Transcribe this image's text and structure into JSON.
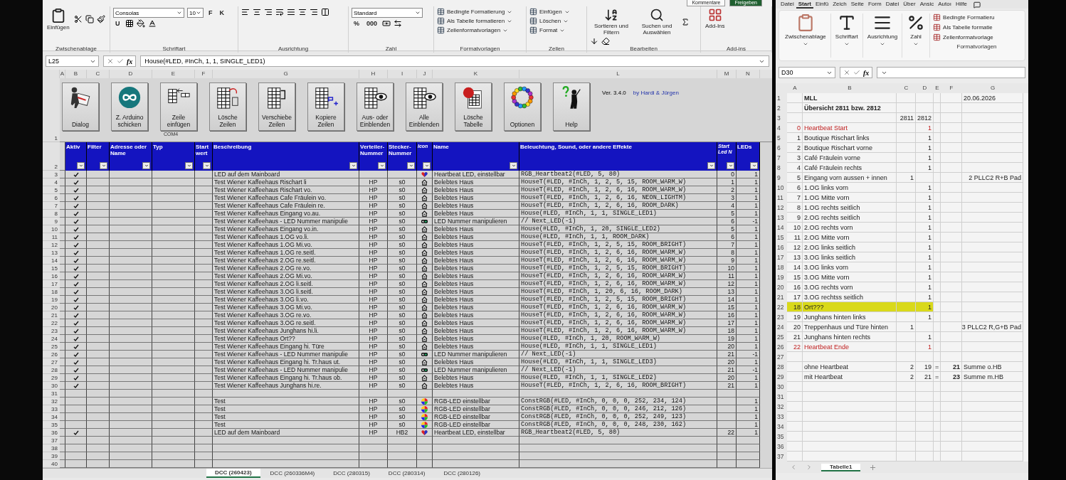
{
  "left_window": {
    "top_buttons": [
      "Kommentare",
      "Freigeben"
    ],
    "ribbon": [
      {
        "label": "Zwischenablage",
        "controls": [
          {
            "kind": "large",
            "label": "Einfügen"
          }
        ]
      },
      {
        "label": "Schriftart",
        "controls": [
          {
            "kind": "field",
            "value": "Consolas"
          },
          {
            "kind": "field",
            "value": "10"
          },
          {
            "kind": "glyph",
            "label": "F"
          },
          {
            "kind": "glyph",
            "label": "K"
          },
          {
            "kind": "glyph",
            "label": "U"
          }
        ]
      },
      {
        "label": "Ausrichtung"
      },
      {
        "label": "Zahl",
        "controls": [
          {
            "kind": "field",
            "value": "Standard"
          },
          {
            "kind": "glyph",
            "label": "%"
          },
          {
            "kind": "glyph",
            "label": "000"
          }
        ]
      },
      {
        "label": "Formatvorlagen",
        "controls": [
          {
            "kind": "small",
            "label": "Bedingte Formatierung"
          },
          {
            "kind": "small",
            "label": "Als Tabelle formatieren"
          },
          {
            "kind": "small",
            "label": "Zellenformatvorlagen"
          }
        ]
      },
      {
        "label": "Zellen",
        "controls": [
          {
            "kind": "small",
            "label": "Einfügen"
          },
          {
            "kind": "small",
            "label": "Löschen"
          },
          {
            "kind": "small",
            "label": "Format"
          }
        ]
      },
      {
        "label": "Bearbeiten",
        "controls": [
          {
            "kind": "large",
            "label": "Sortieren und Filtern"
          },
          {
            "kind": "large",
            "label": "Suchen und Auswählen"
          }
        ]
      },
      {
        "label": "Add-ins",
        "controls": [
          {
            "kind": "large",
            "label": "Add-Ins"
          }
        ]
      }
    ],
    "name_box": "L25",
    "fx": "fx",
    "formula": "House(#LED, #InCh, 1, 1, SINGLE_LED1)",
    "columns": [
      "A",
      "B",
      "C",
      "D",
      "E",
      "F",
      "G",
      "H",
      "I",
      "J",
      "K",
      "L",
      "M",
      "N"
    ],
    "macro_buttons": [
      "Dialog",
      "Z. Arduino schicken",
      "Zeile einfügen",
      "Lösche Zeilen",
      "Verschiebe Zeilen",
      "Kopiere Zeilen",
      "Aus- oder Einblenden",
      "Alle Einblenden",
      "Lösche Tabelle",
      "Optionen",
      "Help"
    ],
    "header_rows": [
      "1",
      "2"
    ],
    "version": "Ver. 3.4.0",
    "authors": "by Hardi & Jürgen",
    "port": "COM4",
    "headers": [
      "Aktiv",
      "Filter",
      "Adresse oder Name",
      "Typ",
      "Start wert",
      "Beschreibung",
      "Verteiler-Nummer",
      "Stecker-Nummer",
      "Icon",
      "Name",
      "Beleuchtung, Sound, oder andere Effekte",
      "Start Led N",
      "LEDs"
    ],
    "rows": [
      {
        "row": "3",
        "aktiv": true,
        "beschreibung": "LED auf dem Mainboard",
        "kind": "heart",
        "name": "Heartbeat LED, einstellbar",
        "effekt": "RGB_Heartbeat2(#LED, 5, 80)",
        "start_led": "0",
        "leds": "1"
      },
      {
        "row": "4",
        "aktiv": true,
        "beschreibung": "Test Wiener Kaffeehaus Rischart li",
        "verteiler": "HP",
        "stecker": "s0",
        "kind": "house",
        "name": "Belebtes Haus",
        "effekt": "HouseT(#LED, #InCh, 1, 2, 5, 15, ROOM_WARM_W)",
        "start_led": "1",
        "leds": "1"
      },
      {
        "row": "5",
        "aktiv": true,
        "beschreibung": "Test Wiener Kaffeehaus Rischart vo.",
        "verteiler": "HP",
        "stecker": "s0",
        "kind": "house",
        "name": "Belebtes Haus",
        "effekt": "HouseT(#LED, #InCh, 1, 2, 6, 16, ROOM_WARM_W)",
        "start_led": "2",
        "leds": "1"
      },
      {
        "row": "6",
        "aktiv": true,
        "beschreibung": "Test Wiener Kaffeehaus Cafe Fräulein vo.",
        "verteiler": "HP",
        "stecker": "s0",
        "kind": "house",
        "name": "Belebtes Haus",
        "effekt": "HouseT(#LED, #InCh, 1, 2, 6, 16, NEON_LIGHTM)",
        "start_led": "3",
        "leds": "1"
      },
      {
        "row": "7",
        "aktiv": true,
        "beschreibung": "Test Wiener Kaffeehaus Cafe Fräulein re.",
        "verteiler": "HP",
        "stecker": "s0",
        "kind": "house",
        "name": "Belebtes Haus",
        "effekt": "HouseT(#LED, #InCh, 1, 2, 6, 16, ROOM_DARK)",
        "start_led": "4",
        "leds": "1"
      },
      {
        "row": "8",
        "aktiv": true,
        "beschreibung": "Test Wiener Kaffeehaus Eingang vo.au.",
        "verteiler": "HP",
        "stecker": "s0",
        "kind": "house",
        "name": "Belebtes Haus",
        "effekt": "House(#LED, #InCh, 1, 1, SINGLE_LED1)",
        "start_led": "5",
        "leds": "1"
      },
      {
        "row": "9",
        "aktiv": true,
        "beschreibung": "Test Wiener Kaffeehaus - LED Nummer manipulie",
        "verteiler": "HP",
        "stecker": "s0",
        "kind": "link",
        "name": "LED Nummer manipulieren",
        "effekt": "// Next_LED(-1)",
        "start_led": "6",
        "leds": "-1"
      },
      {
        "row": "10",
        "aktiv": true,
        "beschreibung": "Test Wiener Kaffeehaus Eingang vo.in.",
        "verteiler": "HP",
        "stecker": "s0",
        "kind": "house",
        "name": "Belebtes Haus",
        "effekt": "House(#LED, #InCh, 1, 20, SINGLE_LED2)",
        "start_led": "5",
        "leds": "1"
      },
      {
        "row": "11",
        "aktiv": true,
        "beschreibung": "Test Wiener Kaffeehaus 1.OG vo.li.",
        "verteiler": "HP",
        "stecker": "s0",
        "kind": "house",
        "name": "Belebtes Haus",
        "effekt": "House(#LED, #InCh, 1, 1, ROOM_DARK)",
        "start_led": "6",
        "leds": "1"
      },
      {
        "row": "12",
        "aktiv": true,
        "beschreibung": "Test Wiener Kaffeehaus 1.OG Mi.vo.",
        "verteiler": "HP",
        "stecker": "s0",
        "kind": "house",
        "name": "Belebtes Haus",
        "effekt": "HouseT(#LED, #InCh, 1, 2, 5, 15, ROOM_BRIGHT)",
        "start_led": "7",
        "leds": "1"
      },
      {
        "row": "13",
        "aktiv": true,
        "beschreibung": "Test Wiener Kaffeehaus 1.OG re.seitl.",
        "verteiler": "HP",
        "stecker": "s0",
        "kind": "house",
        "name": "Belebtes Haus",
        "effekt": "HouseT(#LED, #InCh, 1, 2, 6, 16, ROOM_WARM_W)",
        "start_led": "8",
        "leds": "1"
      },
      {
        "row": "14",
        "aktiv": true,
        "beschreibung": "Test Wiener Kaffeehaus 2.OG re.seitl.",
        "verteiler": "HP",
        "stecker": "s0",
        "kind": "house",
        "name": "Belebtes Haus",
        "effekt": "HouseT(#LED, #InCh, 1, 2, 6, 16, ROOM_WARM_W)",
        "start_led": "9",
        "leds": "1"
      },
      {
        "row": "15",
        "aktiv": true,
        "beschreibung": "Test Wiener Kaffeehaus 2.OG re.vo.",
        "verteiler": "HP",
        "stecker": "s0",
        "kind": "house",
        "name": "Belebtes Haus",
        "effekt": "HouseT(#LED, #InCh, 1, 2, 5, 15, ROOM_BRIGHT)",
        "start_led": "10",
        "leds": "1"
      },
      {
        "row": "16",
        "aktiv": true,
        "beschreibung": "Test Wiener Kaffeehaus 2.OG Mi.vo.",
        "verteiler": "HP",
        "stecker": "s0",
        "kind": "house",
        "name": "Belebtes Haus",
        "effekt": "HouseT(#LED, #InCh, 1, 2, 6, 16, ROOM_WARM_W)",
        "start_led": "11",
        "leds": "1"
      },
      {
        "row": "17",
        "aktiv": true,
        "beschreibung": "Test Wiener Kaffeehaus 2.OG li.seitl.",
        "verteiler": "HP",
        "stecker": "s0",
        "kind": "house",
        "name": "Belebtes Haus",
        "effekt": "HouseT(#LED, #InCh, 1, 2, 6, 16, ROOM_WARM_W)",
        "start_led": "12",
        "leds": "1"
      },
      {
        "row": "18",
        "aktiv": true,
        "beschreibung": "Test Wiener Kaffeehaus 3.OG li.seitl.",
        "verteiler": "HP",
        "stecker": "s0",
        "kind": "house",
        "name": "Belebtes Haus",
        "effekt": "HouseT(#LED, #InCh, 1, 20, 6, 16, ROOM_DARK)",
        "start_led": "13",
        "leds": "1"
      },
      {
        "row": "19",
        "aktiv": true,
        "beschreibung": "Test Wiener Kaffeehaus 3.OG li.vo.",
        "verteiler": "HP",
        "stecker": "s0",
        "kind": "house",
        "name": "Belebtes Haus",
        "effekt": "HouseT(#LED, #InCh, 1, 2, 5, 15, ROOM_BRIGHT)",
        "start_led": "14",
        "leds": "1"
      },
      {
        "row": "20",
        "aktiv": true,
        "beschreibung": "Test Wiener Kaffeehaus 3.OG Mi.vo.",
        "verteiler": "HP",
        "stecker": "s0",
        "kind": "house",
        "name": "Belebtes Haus",
        "effekt": "HouseT(#LED, #InCh, 1, 2, 6, 16, ROOM_WARM_W)",
        "start_led": "15",
        "leds": "1"
      },
      {
        "row": "21",
        "aktiv": true,
        "beschreibung": "Test Wiener Kaffeehaus 3.OG re.vo.",
        "verteiler": "HP",
        "stecker": "s0",
        "kind": "house",
        "name": "Belebtes Haus",
        "effekt": "HouseT(#LED, #InCh, 1, 2, 6, 16, ROOM_WARM_W)",
        "start_led": "16",
        "leds": "1"
      },
      {
        "row": "22",
        "aktiv": true,
        "beschreibung": "Test Wiener Kaffeehaus 3.OG re.seitl.",
        "verteiler": "HP",
        "stecker": "s0",
        "kind": "house",
        "name": "Belebtes Haus",
        "effekt": "HouseT(#LED, #InCh, 1, 2, 6, 16, ROOM_WARM_W)",
        "start_led": "17",
        "leds": "1"
      },
      {
        "row": "23",
        "aktiv": true,
        "beschreibung": "Test Wiener Kaffeehaus Junghans hi.li.",
        "verteiler": "HP",
        "stecker": "s0",
        "kind": "house",
        "name": "Belebtes Haus",
        "effekt": "HouseT(#LED, #InCh, 1, 2, 6, 16, ROOM_WARM_W)",
        "start_led": "18",
        "leds": "1"
      },
      {
        "row": "24",
        "aktiv": true,
        "beschreibung": "Test Wiener Kaffeehaus Ort??",
        "verteiler": "HP",
        "stecker": "s0",
        "kind": "house",
        "name": "Belebtes Haus",
        "effekt": "House(#LED, #InCh, 1, 20, ROOM_WARM_W)",
        "start_led": "19",
        "leds": "1"
      },
      {
        "row": "25",
        "aktiv": true,
        "beschreibung": "Test Wiener Kaffeehaus Eingang hi. Türe",
        "verteiler": "HP",
        "stecker": "s0",
        "kind": "house",
        "name": "Belebtes Haus",
        "effekt": "House(#LED, #InCh, 1, 1, SINGLE_LED1)",
        "start_led": "20",
        "leds": "1"
      },
      {
        "row": "26",
        "aktiv": true,
        "beschreibung": "Test Wiener Kaffeehaus - LED Nummer manipulie",
        "verteiler": "HP",
        "stecker": "s0",
        "kind": "link",
        "name": "LED Nummer manipulieren",
        "effekt": "// Next_LED(-1)",
        "start_led": "21",
        "leds": "-1"
      },
      {
        "row": "27",
        "aktiv": true,
        "beschreibung": "Test Wiener Kaffeehaus Eingang hi. Tr.haus ut.",
        "verteiler": "HP",
        "stecker": "s0",
        "kind": "house",
        "name": "Belebtes Haus",
        "effekt": "House(#LED, #InCh, 1, 1, SINGLE_LED3)",
        "start_led": "20",
        "leds": "1"
      },
      {
        "row": "28",
        "aktiv": true,
        "beschreibung": "Test Wiener Kaffeehaus - LED Nummer manipulie",
        "verteiler": "HP",
        "stecker": "s0",
        "kind": "link",
        "name": "LED Nummer manipulieren",
        "effekt": "// Next_LED(-1)",
        "start_led": "21",
        "leds": "-1"
      },
      {
        "row": "29",
        "aktiv": true,
        "beschreibung": "Test Wiener Kaffeehaus Eingang hi. Tr.haus ob.",
        "verteiler": "HP",
        "stecker": "s0",
        "kind": "house",
        "name": "Belebtes Haus",
        "effekt": "House(#LED, #InCh, 1, 1, SINGLE_LED2)",
        "start_led": "20",
        "leds": "1"
      },
      {
        "row": "30",
        "aktiv": true,
        "beschreibung": "Test Wiener Kaffeehaus Junghans hi.re.",
        "verteiler": "HP",
        "stecker": "s0",
        "kind": "house",
        "name": "Belebtes Haus",
        "effekt": "HouseT(#LED, #InCh, 1, 2, 6, 16, ROOM_BRIGHT)",
        "start_led": "21",
        "leds": "1"
      },
      {
        "row": "31",
        "aktiv": false,
        "kind": "none"
      },
      {
        "row": "32",
        "aktiv": false,
        "beschreibung": "Test",
        "verteiler": "HP",
        "stecker": "s0",
        "kind": "rgb",
        "name": "RGB-LED einstellbar",
        "effekt": "ConstRGB(#LED, #InCh, 0, 0, 0, 252, 234, 124)",
        "leds": "1"
      },
      {
        "row": "33",
        "aktiv": false,
        "beschreibung": "Test",
        "verteiler": "HP",
        "stecker": "s0",
        "kind": "rgb",
        "name": "RGB-LED einstellbar",
        "effekt": "ConstRGB(#LED, #InCh, 0, 0, 0, 246, 212, 126)",
        "leds": "1"
      },
      {
        "row": "34",
        "aktiv": false,
        "beschreibung": "Test",
        "verteiler": "HP",
        "stecker": "s0",
        "kind": "rgb",
        "name": "RGB-LED einstellbar",
        "effekt": "ConstRGB(#LED, #InCh, 0, 0, 0, 252, 249, 123)",
        "leds": "1"
      },
      {
        "row": "35",
        "aktiv": false,
        "beschreibung": "Test",
        "verteiler": "HP",
        "stecker": "s0",
        "kind": "rgb",
        "name": "RGB-LED einstellbar",
        "effekt": "ConstRGB(#LED, #InCh, 0, 0, 0, 248, 230, 162)",
        "leds": "1"
      },
      {
        "row": "36",
        "aktiv": true,
        "beschreibung": "LED auf dem Mainboard",
        "verteiler": "HP",
        "stecker": "HB2",
        "kind": "heart",
        "name": "Heartbeat LED, einstellbar",
        "effekt": "RGB_Heartbeat2(#LED, 5, 80)",
        "start_led": "22",
        "leds": "1"
      },
      {
        "row": "37",
        "aktiv": false,
        "kind": "none"
      },
      {
        "row": "38",
        "aktiv": false,
        "kind": "none"
      },
      {
        "row": "39",
        "aktiv": false,
        "kind": "none"
      },
      {
        "row": "40",
        "aktiv": false,
        "kind": "none"
      }
    ],
    "sheet_tabs": [
      {
        "label": "DCC (260423)",
        "selected": true
      },
      {
        "label": "DCC (260336M4)",
        "selected": false
      },
      {
        "label": "DCC (280315)",
        "selected": false
      },
      {
        "label": "DCC (280314)",
        "selected": false
      },
      {
        "label": "DCC (280126)",
        "selected": false
      }
    ]
  },
  "right_window": {
    "menu": [
      {
        "label": "Datei",
        "selected": false
      },
      {
        "label": "Start",
        "selected": true
      },
      {
        "label": "Einfü",
        "selected": false
      },
      {
        "label": "Zeich",
        "selected": false
      },
      {
        "label": "Seite",
        "selected": false
      },
      {
        "label": "Form",
        "selected": false
      },
      {
        "label": "Datei",
        "selected": false
      },
      {
        "label": "Über",
        "selected": false
      },
      {
        "label": "Ansic",
        "selected": false
      },
      {
        "label": "Autoı",
        "selected": false
      },
      {
        "label": "Hilfe",
        "selected": false
      }
    ],
    "ribbon": [
      {
        "label": "Zwischenablage"
      },
      {
        "label": "Schriftart"
      },
      {
        "label": "Ausrichtung"
      },
      {
        "label": "Zahl"
      },
      {
        "label": "Formatvorlagen",
        "items": [
          "Bedingte Formatieru",
          "Als Tabelle formatie",
          "Zellenformatvorlage"
        ]
      }
    ],
    "name_box": "D30",
    "fx": "fx",
    "columns": [
      "A",
      "B",
      "C",
      "D",
      "E",
      "F",
      "G"
    ],
    "rows": [
      {
        "n": "1",
        "col_b": "MLL",
        "col_g": "20.06.2026",
        "kind": "title"
      },
      {
        "n": "2",
        "col_b": "Übersicht 2811 bzw. 2812",
        "kind": "title"
      },
      {
        "n": "3",
        "col_c": "2811",
        "col_d": "2812",
        "kind": "plain"
      },
      {
        "n": "4",
        "col_a": "0",
        "col_b": "Heartbeat Start",
        "col_d": "1",
        "kind": "red"
      },
      {
        "n": "5",
        "col_a": "1",
        "col_b": "Boutique Rischart links",
        "col_d": "1",
        "kind": "plain"
      },
      {
        "n": "6",
        "col_a": "2",
        "col_b": "Boutique Rischart vorne",
        "col_d": "1",
        "kind": "plain"
      },
      {
        "n": "7",
        "col_a": "3",
        "col_b": "Café Fräulein vorne",
        "col_d": "1",
        "kind": "plain"
      },
      {
        "n": "8",
        "col_a": "4",
        "col_b": "Café Fräulein rechts",
        "col_d": "1",
        "kind": "plain"
      },
      {
        "n": "9",
        "col_a": "5",
        "col_b": "Eingang vorn aussen + innen",
        "col_c": "1",
        "col_g": "2 PLLC2 R+B Pad",
        "kind": "plain"
      },
      {
        "n": "10",
        "col_a": "6",
        "col_b": "1.OG links vorn",
        "col_d": "1",
        "kind": "plain"
      },
      {
        "n": "11",
        "col_a": "7",
        "col_b": "1.OG Mitte vorn",
        "col_d": "1",
        "kind": "plain"
      },
      {
        "n": "12",
        "col_a": "8",
        "col_b": "1.OG rechts seitlich",
        "col_d": "1",
        "kind": "plain"
      },
      {
        "n": "13",
        "col_a": "9",
        "col_b": "2.OG rechts seitlich",
        "col_d": "1",
        "kind": "plain"
      },
      {
        "n": "14",
        "col_a": "10",
        "col_b": "2.OG rechts vorn",
        "col_d": "1",
        "kind": "plain"
      },
      {
        "n": "15",
        "col_a": "11",
        "col_b": "2.OG Mitte vorn",
        "col_d": "1",
        "kind": "plain"
      },
      {
        "n": "16",
        "col_a": "12",
        "col_b": "2.OG links seitlich",
        "col_d": "1",
        "kind": "plain"
      },
      {
        "n": "17",
        "col_a": "13",
        "col_b": "3.OG links seitlich",
        "col_d": "1",
        "kind": "plain"
      },
      {
        "n": "18",
        "col_a": "14",
        "col_b": "3.OG links vorn",
        "col_d": "1",
        "kind": "plain"
      },
      {
        "n": "19",
        "col_a": "15",
        "col_b": "3.OG Mitte vorn",
        "col_d": "1",
        "kind": "plain"
      },
      {
        "n": "20",
        "col_a": "16",
        "col_b": "3.OG rechts vorn",
        "col_d": "1",
        "kind": "plain"
      },
      {
        "n": "21",
        "col_a": "17",
        "col_b": "3.OG rechtss seitlich",
        "col_d": "1",
        "kind": "plain"
      },
      {
        "n": "22",
        "col_a": "18",
        "col_b": "Ort???",
        "col_d": "1",
        "kind": "highlight"
      },
      {
        "n": "23",
        "col_a": "19",
        "col_b": "Junghans hinten links",
        "col_d": "1",
        "kind": "plain"
      },
      {
        "n": "24",
        "col_a": "20",
        "col_b": "Treppenhaus und Türe hinten",
        "col_c": "1",
        "col_g": "3 PLLC2 R,G+B Pad",
        "kind": "plain"
      },
      {
        "n": "25",
        "col_a": "21",
        "col_b": "Junghans hinten rechts",
        "col_d": "1",
        "kind": "plain"
      },
      {
        "n": "26",
        "col_a": "22",
        "col_b": "Heartbeat Ende",
        "col_d": "1",
        "kind": "red"
      },
      {
        "n": "27",
        "kind": "plain"
      },
      {
        "n": "28",
        "col_b": "ohne Heartbeat",
        "col_c": "2",
        "col_d": "19",
        "col_e": "=",
        "col_f": "21",
        "col_g": "Summe o.HB",
        "kind": "total"
      },
      {
        "n": "29",
        "col_b": "mit Heartbeat",
        "col_c": "2",
        "col_d": "21",
        "col_e": "=",
        "col_f": "23",
        "col_g": "Summe m.HB",
        "kind": "total"
      },
      {
        "n": "30",
        "kind": "plain"
      },
      {
        "n": "31",
        "kind": "plain"
      },
      {
        "n": "32",
        "kind": "plain"
      },
      {
        "n": "33",
        "kind": "plain"
      },
      {
        "n": "34",
        "kind": "plain"
      },
      {
        "n": "35",
        "kind": "plain"
      },
      {
        "n": "36",
        "kind": "plain"
      },
      {
        "n": "37",
        "kind": "plain"
      }
    ],
    "sheet_tabs": [
      {
        "label": "Tabelle1",
        "selected": true
      }
    ]
  }
}
